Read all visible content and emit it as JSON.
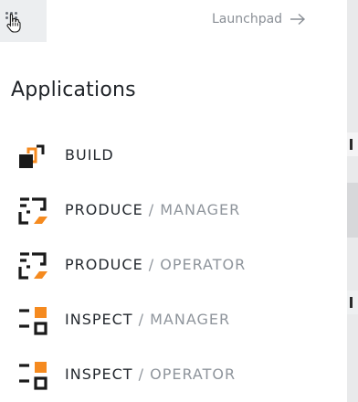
{
  "header": {
    "launchpad_label": "Launchpad"
  },
  "heading": "Applications",
  "apps": [
    {
      "name": "BUILD",
      "separator": "",
      "role": "",
      "icon": "build-icon"
    },
    {
      "name": "PRODUCE",
      "separator": " / ",
      "role": "MANAGER",
      "icon": "produce-icon"
    },
    {
      "name": "PRODUCE",
      "separator": " / ",
      "role": "OPERATOR",
      "icon": "produce-icon"
    },
    {
      "name": "INSPECT",
      "separator": " / ",
      "role": "MANAGER",
      "icon": "inspect-icon"
    },
    {
      "name": "INSPECT",
      "separator": " / ",
      "role": "OPERATOR",
      "icon": "inspect-icon"
    }
  ],
  "colors": {
    "accent": "#f58a1f",
    "icon_dark": "#1a1a1a",
    "text_primary": "#24292f",
    "text_muted": "#8f959c"
  }
}
